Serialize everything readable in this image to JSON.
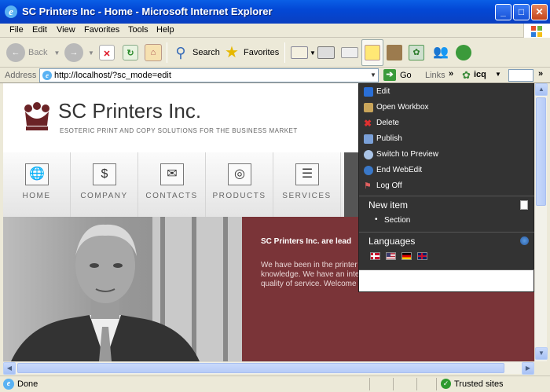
{
  "window": {
    "title": "SC Printers Inc - Home - Microsoft Internet Explorer"
  },
  "menu": [
    "File",
    "Edit",
    "View",
    "Favorites",
    "Tools",
    "Help"
  ],
  "toolbar": {
    "back_label": "Back",
    "search_label": "Search",
    "favorites_label": "Favorites"
  },
  "address": {
    "label": "Address",
    "url": "http://localhost/?sc_mode=edit",
    "go_label": "Go",
    "links_label": "Links",
    "icq_label": "icq"
  },
  "site": {
    "title": "SC Printers Inc.",
    "tagline": "ESOTERIC PRINT AND COPY SOLUTIONS FOR THE BUSINESS MARKET",
    "nav": [
      "HOME",
      "COMPANY",
      "CONTACTS",
      "PRODUCTS",
      "SERVICES"
    ],
    "heading": "SC Printers Inc. are lead",
    "body_lines": [
      "We have been in the printer",
      "knowledge. We have an inte",
      "quality of service. Welcome"
    ]
  },
  "webedit": {
    "items": [
      "Edit",
      "Open Workbox",
      "Delete",
      "Publish",
      "Switch to Preview",
      "End WebEdit",
      "Log Off"
    ],
    "new_item_label": "New item",
    "new_item_option": "Section",
    "languages_label": "Languages",
    "flags": [
      "danish-flag",
      "us-flag",
      "german-flag",
      "uk-flag"
    ]
  },
  "status": {
    "text": "Done",
    "zone": "Trusted sites"
  },
  "colors": {
    "titlebar": "#0a5fe6",
    "maroon": "#7a3438",
    "menu_bg": "#333333"
  }
}
